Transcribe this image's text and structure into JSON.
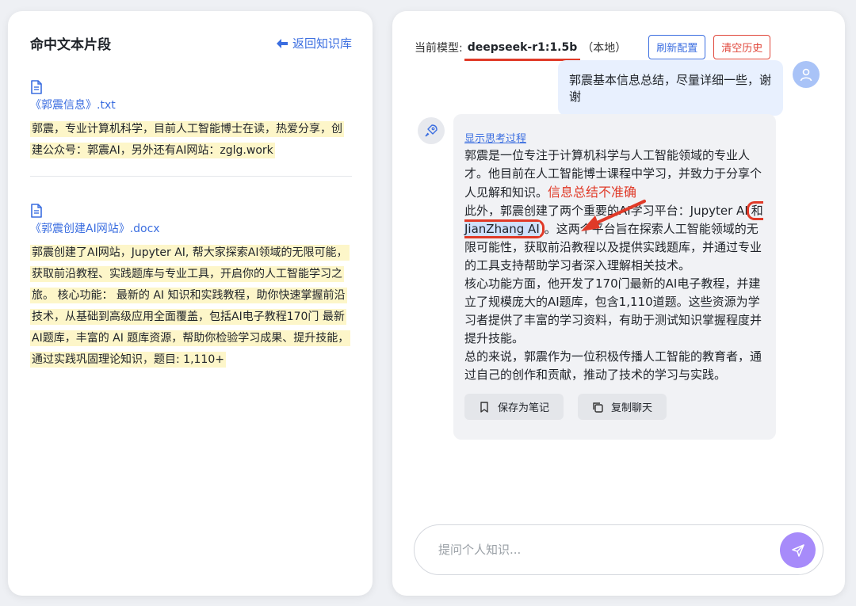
{
  "left_panel": {
    "title": "命中文本片段",
    "back_label": "返回知识库",
    "hits": [
      {
        "file_name": "《郭震信息》.txt",
        "snippet": "郭震，专业计算机科学，目前人工智能博士在读，热爱分享，创建公众号：郭震AI，另外还有AI网站：zglg.work"
      },
      {
        "file_name": "《郭震创建AI网站》.docx",
        "snippet": "郭震创建了AI网站，Jupyter AI, 帮大家探索AI领域的无限可能，获取前沿教程、实践题库与专业工具，开启你的人工智能学习之旅。 核心功能： 最新的 AI 知识和实践教程，助你快速掌握前沿技术，从基础到高级应用全面覆盖，包括AI电子教程170门 最新AI题库，丰富的 AI 题库资源，帮助你检验学习成果、提升技能，通过实践巩固理论知识，题目: 1,110+"
      }
    ]
  },
  "chat": {
    "model_label": "当前模型:",
    "model_name": "deepseek-r1:1.5b",
    "model_location": "（本地）",
    "refresh_label": "刷新配置",
    "clear_label": "清空历史",
    "user_message": "郭震基本信息总结，尽量详细一些，谢谢",
    "show_thinking": "显示思考过程",
    "answer": {
      "p1": "郭震是一位专注于计算机科学与人工智能领域的专业人才。他目前在人工智能博士课程中学习，并致力于分享个人见解和知识。",
      "annotation": "信息总结不准确",
      "p2_start": "此外，郭震创建了两个重要的AI学习平台：Jupyter AI",
      "p2_he": "和",
      "p2_mark": "JianZhang AI",
      "p2_end": "。这两个平台旨在探索人工智能领域的无限可能性，获取前沿教程以及提供实践题库，并通过专业的工具支持帮助学习者深入理解相关技术。",
      "p3": "核心功能方面，他开发了170门最新的AI电子教程，并建立了规模庞大的AI题库，包含1,110道题。这些资源为学习者提供了丰富的学习资料，有助于测试知识掌握程度并提升技能。",
      "p4": "总的来说，郭震作为一位积极传播人工智能的教育者，通过自己的创作和贡献，推动了技术的学习与实践。"
    },
    "save_note_label": "保存为笔记",
    "copy_chat_label": "复制聊天",
    "input_placeholder": "提问个人知识..."
  },
  "colors": {
    "accent": "#3b6ee0",
    "danger": "#e03a28",
    "send": "#a78bfa",
    "highlight": "#fdf6c9"
  }
}
